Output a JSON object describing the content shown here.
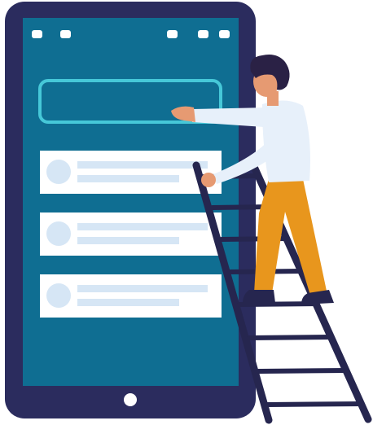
{
  "illustration": {
    "subject": "person-on-ladder-reaching-phone-screen",
    "icons": [
      "phone-device",
      "status-dots",
      "search-bar",
      "list-item-placeholder",
      "home-button",
      "ladder",
      "person"
    ],
    "colors": {
      "background": "#ffffff",
      "phone_frame": "#2b2c5e",
      "screen": "#0f6e92",
      "search_outline": "#46c8d8",
      "card_bg": "#ffffff",
      "placeholder_line": "#d6e6f5",
      "avatar_circle": "#d6e6f5",
      "status_dot": "#ffffff",
      "home_button": "#ffffff",
      "ladder": "#26264f",
      "shirt": "#e7f0fa",
      "pants": "#e8961d",
      "skin": "#e69a72",
      "hair": "#2a2145",
      "shoes": "#26264f"
    },
    "list_items": [
      {
        "has_avatar": true,
        "lines": 2
      },
      {
        "has_avatar": true,
        "lines": 2
      },
      {
        "has_avatar": true,
        "lines": 2
      }
    ]
  }
}
